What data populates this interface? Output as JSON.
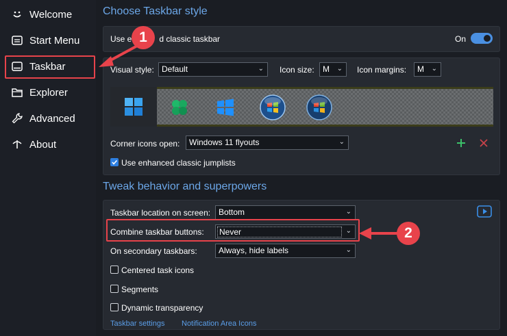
{
  "sidebar": {
    "items": [
      {
        "label": "Welcome",
        "icon": "smile-icon"
      },
      {
        "label": "Start Menu",
        "icon": "window-icon"
      },
      {
        "label": "Taskbar",
        "icon": "taskbar-icon"
      },
      {
        "label": "Explorer",
        "icon": "folder-icon"
      },
      {
        "label": "Advanced",
        "icon": "wrench-icon"
      },
      {
        "label": "About",
        "icon": "info-icon"
      }
    ],
    "selected": "Taskbar"
  },
  "taskbar_style": {
    "title": "Choose Taskbar style",
    "classic_label": "Use e            d classic taskbar",
    "toggle_label": "On",
    "toggle_on": true,
    "visual_style_label": "Visual style:",
    "visual_style_value": "Default",
    "icon_size_label": "Icon size:",
    "icon_size_value": "M",
    "icon_margins_label": "Icon margins:",
    "icon_margins_value": "M",
    "preview_styles": [
      "windows-11-logo-icon",
      "clover-logo-icon",
      "windows-10-logo-icon",
      "windows-7-orb-icon",
      "windows-vista-orb-icon"
    ],
    "corner_icons_label": "Corner icons open:",
    "corner_icons_value": "Windows 11 flyouts",
    "jumplists_label": "Use enhanced classic jumplists",
    "jumplists_checked": true
  },
  "behavior": {
    "title": "Tweak behavior and superpowers",
    "location_label": "Taskbar location on screen:",
    "location_value": "Bottom",
    "combine_label": "Combine taskbar buttons:",
    "combine_value": "Never",
    "secondary_label": "On secondary taskbars:",
    "secondary_value": "Always, hide labels",
    "centered_label": "Centered task icons",
    "segments_label": "Segments",
    "transparency_label": "Dynamic transparency",
    "link_taskbar_settings": "Taskbar settings",
    "link_notification": "Notification Area Icons"
  },
  "annotations": {
    "badge_1": "1",
    "badge_2": "2",
    "accent_color": "#e8434b"
  }
}
